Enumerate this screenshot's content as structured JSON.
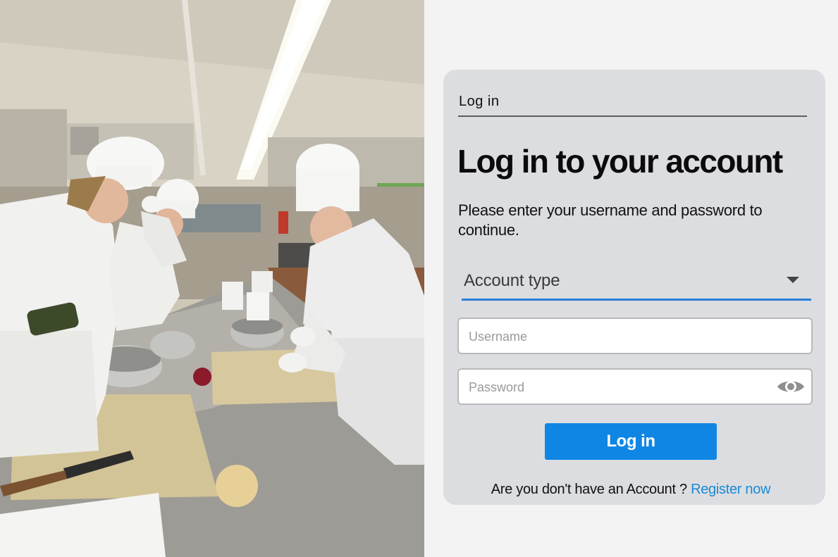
{
  "photo": {
    "subject": "culinary-students-kitchen-photo"
  },
  "login": {
    "tab_label": "Log in",
    "heading": "Log in to your account",
    "subtext": "Please enter your username and password to continue.",
    "account_type": {
      "selected": "Account type"
    },
    "username": {
      "value": "",
      "placeholder": "Username"
    },
    "password": {
      "value": "",
      "placeholder": "Password",
      "visibility_icon": "eye-icon"
    },
    "submit_label": "Log in",
    "register_prompt": "Are you don't have an Account ?",
    "register_link": "Register now"
  },
  "colors": {
    "page_bg": "#f3f3f3",
    "card_bg": "#dcdde0",
    "accent": "#0f86e4",
    "select_underline": "#2a7fd8",
    "link": "#1a8ad6"
  }
}
